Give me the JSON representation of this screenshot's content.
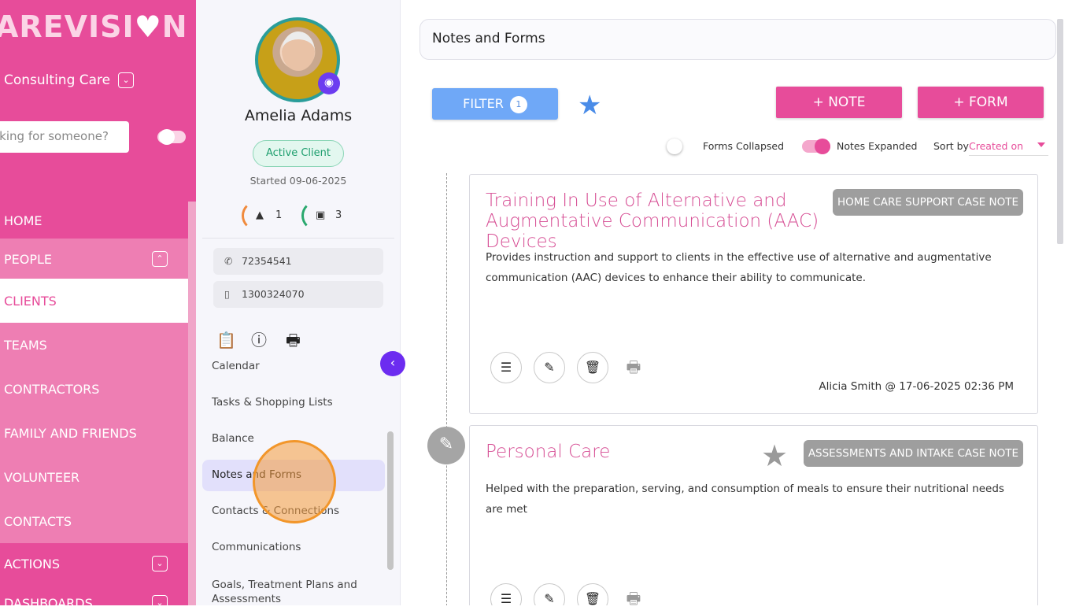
{
  "sidebar": {
    "logo_text": "AREVISI",
    "logo_end": "N",
    "org_name": "Consulting Care",
    "search_placeholder": "oking for someone?",
    "nav": [
      {
        "label": "HOME"
      },
      {
        "label": "PEOPLE"
      },
      {
        "label": "CLIENTS"
      },
      {
        "label": "TEAMS"
      },
      {
        "label": "CONTRACTORS"
      },
      {
        "label": "FAMILY AND FRIENDS"
      },
      {
        "label": "VOLUNTEER"
      },
      {
        "label": "CONTACTS"
      },
      {
        "label": "ACTIONS"
      },
      {
        "label": "DASHBOARDS"
      }
    ]
  },
  "client": {
    "name": "Amelia Adams",
    "status": "Active Client",
    "started": "Started 09-06-2025",
    "alerts_count": "1",
    "wallet_count": "3",
    "phone": "72354541",
    "mobile": "1300324070",
    "menu": [
      {
        "label": "Calendar"
      },
      {
        "label": "Tasks & Shopping Lists"
      },
      {
        "label": "Balance"
      },
      {
        "label": "Notes and Forms"
      },
      {
        "label": "Contacts & Connections"
      },
      {
        "label": "Communications"
      },
      {
        "label": "Goals, Treatment Plans and Assessments"
      }
    ]
  },
  "main": {
    "title": "Notes and Forms",
    "filter_label": "FILTER",
    "filter_count": "1",
    "note_button": "+ NOTE",
    "form_button": "+ FORM",
    "forms_toggle_label": "Forms Collapsed",
    "notes_toggle_label": "Notes Expanded",
    "sort_label": "Sort by",
    "sort_value": "Created on",
    "cards": [
      {
        "title": "Training In Use of Alternative and Augmentative Communication (AAC) Devices",
        "tag": "HOME CARE SUPPORT CASE NOTE",
        "description": "Provides instruction and support to clients in the effective use of alternative and augmentative communication (AAC) devices to enhance their ability to communicate.",
        "meta": "Alicia Smith @ 17-06-2025 02:36 PM"
      },
      {
        "title": "Personal Care",
        "tag": "ASSESSMENTS AND INTAKE CASE NOTE",
        "description": "Helped with the preparation, serving, and consumption of meals to ensure their nutritional needs are met"
      }
    ]
  },
  "colors": {
    "brand_pink": "#e74c9a",
    "filter_blue": "#6fa8f7",
    "active_menu": "#e2e0fb",
    "accent_purple": "#6c2cf0"
  }
}
